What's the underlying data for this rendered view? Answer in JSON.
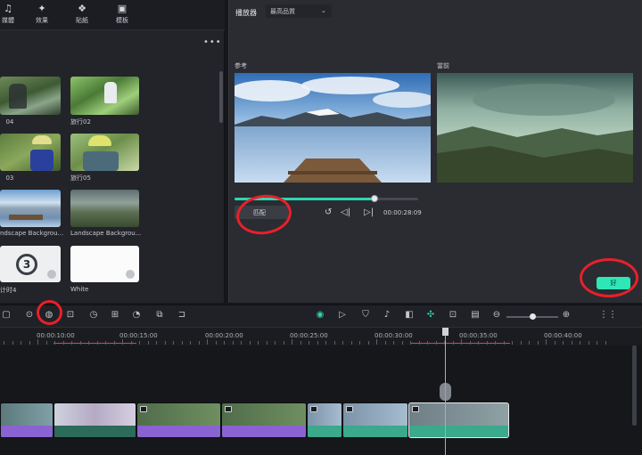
{
  "topbar": {
    "tabs": [
      {
        "label": "媒體",
        "icon": "music-icon"
      },
      {
        "label": "效果",
        "icon": "star-icon"
      },
      {
        "label": "貼紙",
        "icon": "sticker-icon"
      },
      {
        "label": "模板",
        "icon": "template-icon"
      }
    ]
  },
  "media": {
    "more": "•••",
    "items": [
      {
        "label": "ㅤ04",
        "thumb": "cyclists-forest"
      },
      {
        "label": "旅行02",
        "thumb": "cyclist-trail"
      },
      {
        "label": "ㅤ03",
        "thumb": "cyclist-helmet"
      },
      {
        "label": "旅行05",
        "thumb": "cyclist-closeup"
      },
      {
        "label": "ndscape Backgrou...",
        "thumb": "lake-pier"
      },
      {
        "label": "Landscape Backgrou...",
        "thumb": "mountain-valley"
      },
      {
        "label": "计时4",
        "thumb": "countdown-3"
      },
      {
        "label": "White",
        "thumb": "white"
      }
    ]
  },
  "player": {
    "title": "播放器",
    "quality": "最高品質",
    "reference_label": "参考",
    "current_label": "當前",
    "match_button": "匹配",
    "timecode": "00:00:28:09",
    "progress": 0.76,
    "ok_button": "好"
  },
  "timeline": {
    "ticks": [
      "00:00:10:00",
      "00:00:15:00",
      "00:00:20:00",
      "00:00:25:00",
      "00:00:30:00",
      "00:00:35:00",
      "00:00:40:00"
    ]
  },
  "colors": {
    "accent": "#2fd6b0",
    "ok": "#2ee6b6",
    "annotation": "#e8202a",
    "clip_purple": "#8a63d2",
    "clip_teal": "#3aa98c"
  }
}
